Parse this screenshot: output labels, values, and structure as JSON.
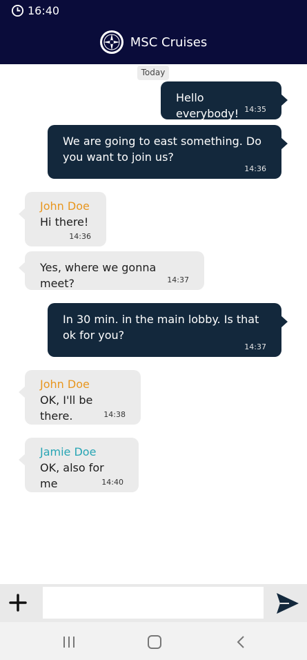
{
  "status_bar": {
    "time": "16:40",
    "icon": "clock-icon"
  },
  "header": {
    "title": "MSC Cruises",
    "logo_icon": "compass-logo-icon"
  },
  "chat": {
    "day_label": "Today",
    "messages": [
      {
        "direction": "outgoing",
        "text": "Hello everybody!",
        "time": "14:35"
      },
      {
        "direction": "outgoing",
        "text": "We are going to east something. Do you want to join us?",
        "time": "14:36"
      },
      {
        "direction": "incoming",
        "sender": "John Doe",
        "text": "Hi there!",
        "time": "14:36"
      },
      {
        "direction": "incoming",
        "text": "Yes, where we gonna meet?",
        "time": "14:37"
      },
      {
        "direction": "outgoing",
        "text": "In 30 min. in the main lobby. Is that ok for you?",
        "time": "14:37"
      },
      {
        "direction": "incoming",
        "sender": "John Doe",
        "text": "OK, I'll be there.",
        "time": "14:38"
      },
      {
        "direction": "incoming",
        "sender": "Jamie Doe",
        "text": "OK, also for me",
        "time": "14:40"
      }
    ]
  },
  "composer": {
    "input_value": "",
    "add_icon": "plus-icon",
    "send_icon": "send-icon"
  },
  "nav_bar": {
    "recents_icon": "recents-icon",
    "home_icon": "home-icon",
    "back_icon": "back-icon"
  },
  "colors": {
    "header_bg": "#0a0c3a",
    "outgoing_bubble": "#13283c",
    "incoming_bubble": "#ebebeb",
    "sender_john": "#e8961e",
    "sender_jamie": "#27a5b4"
  }
}
